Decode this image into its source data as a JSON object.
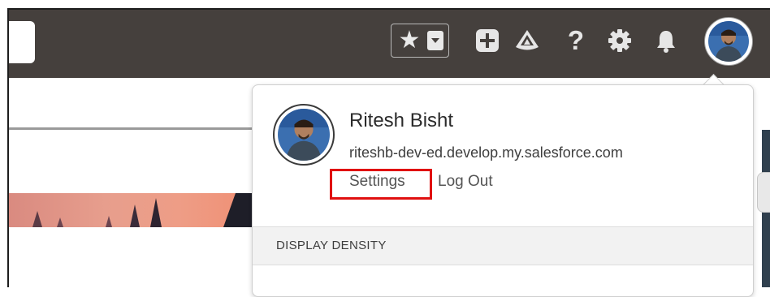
{
  "header": {
    "icons": [
      "star-icon",
      "chevron-down-icon",
      "plus-icon",
      "trailhead-icon",
      "help-icon",
      "gear-icon",
      "bell-icon"
    ],
    "help_glyph": "?",
    "star_glyph": "★"
  },
  "user_menu": {
    "name": "Ritesh Bisht",
    "username": "riteshb-dev-ed.develop.my.salesforce.com",
    "settings_label": "Settings",
    "logout_label": "Log Out",
    "section_title": "DISPLAY DENSITY"
  },
  "colors": {
    "header_bg": "#45403d",
    "highlight": "#e01010",
    "section_bg": "#f2f2f2"
  }
}
